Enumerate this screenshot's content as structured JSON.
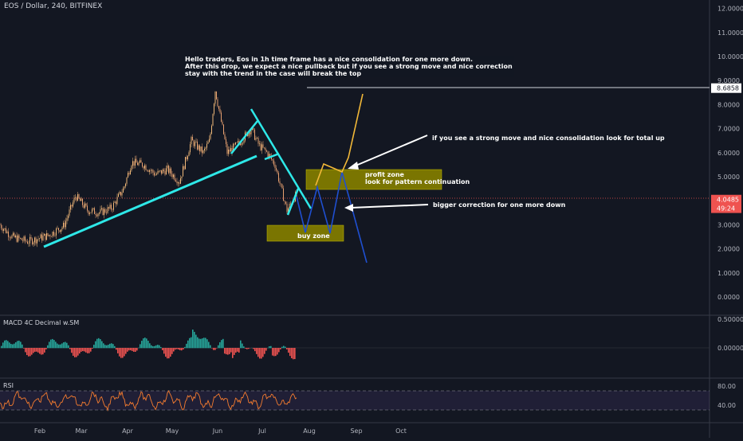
{
  "header": {
    "symbol": "EOS / Dollar, 240, BITFINEX"
  },
  "price_axis": {
    "ticks": [
      "12.0000",
      "11.0000",
      "10.0000",
      "9.0000",
      "8.0000",
      "7.0000",
      "6.0000",
      "5.0000",
      "4.0000",
      "3.0000",
      "2.0000",
      "1.0000",
      "0.0000"
    ],
    "badges": [
      {
        "label": "8.6858",
        "value": 8.6858,
        "kind": "alert"
      },
      {
        "label": "4.0485",
        "value": 4.0485,
        "kind": "last"
      },
      {
        "label": "49:24",
        "value": 3.69,
        "kind": "timer"
      }
    ]
  },
  "macd": {
    "title": "MACD 4C Decimal w.SM",
    "ticks": [
      "0.50000",
      "0.00000"
    ]
  },
  "rsi": {
    "title": "RSI",
    "ticks": [
      "80.00",
      "40.00"
    ]
  },
  "time_axis": {
    "labels": [
      "Feb",
      "Mar",
      "Apr",
      "May",
      "Jun",
      "Jul",
      "Aug",
      "Sep",
      "Oct"
    ]
  },
  "annotations": {
    "main_note": "Hello traders, Eos in 1h time frame has a nice consolidation for one more down.\nAfter this drop, we expect a nice pullback but if you see a strong move and nice correction\nstay with the trend in the case will break the top",
    "profit_zone": "profit zone\nlook for pattern continuation",
    "buy_zone": "buy zone",
    "strong_move_note": "if you see a strong move and nice consolidation look for total up",
    "correction_note": "bigger correction for one more down"
  },
  "colors": {
    "background": "#131722",
    "candle_up": "#f0b878",
    "candle_down": "#e8a070",
    "trendline": "#2ee8e8",
    "zone": "#7f7a00",
    "projection_down": "#1f4fd0",
    "projection_up": "#f2b838",
    "macd_green": "#26a69a",
    "macd_red": "#ef5350",
    "rsi_line": "#f57c2f",
    "rsi_band": "#7e57c2"
  }
}
